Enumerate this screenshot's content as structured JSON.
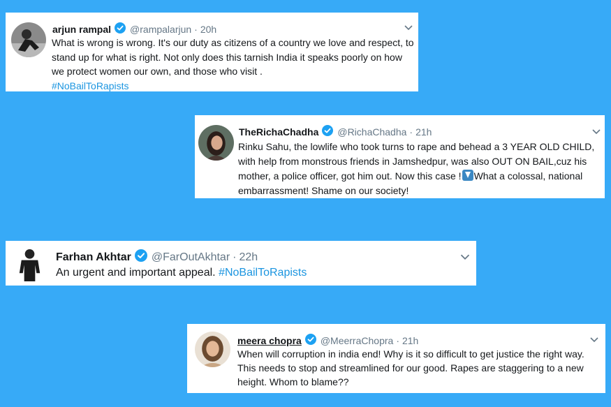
{
  "tweets": [
    {
      "name": "arjun rampal",
      "handle": "@rampalarjun",
      "separator": "·",
      "time": "20h",
      "text": "What is wrong is wrong. It's our duty as citizens of a country we love and respect, to stand up for what is right. Not only does this tarnish India it speaks poorly on how we protect women our own, and those who visit .",
      "hashtag": "#NoBailToRapists",
      "avatar_icon": "person-photo-avatar",
      "menu_icon": "chevron-down-icon"
    },
    {
      "name": "TheRichaChadha",
      "handle": "@RichaChadha",
      "separator": "·",
      "time": "21h",
      "text_before_emoji": "Rinku Sahu, the lowlife who took turns to rape and behead a 3 YEAR OLD CHILD, with help from monstrous friends in Jamshedpur, was also OUT ON BAIL,cuz his mother, a police officer, got him out. Now this case !",
      "emoji": "down-arrow-emoji",
      "text_after_emoji": "What a colossal, national embarrassment! Shame on our society!",
      "avatar_icon": "person-photo-avatar",
      "menu_icon": "chevron-down-icon"
    },
    {
      "name": "Farhan Akhtar",
      "handle": "@FarOutAkhtar",
      "separator": "·",
      "time": "22h",
      "text": "An urgent and important appeal.",
      "hashtag": "#NoBailToRapists",
      "avatar_icon": "person-photo-avatar",
      "menu_icon": "chevron-down-icon"
    },
    {
      "name": "meera chopra",
      "handle": "@MeerraChopra",
      "separator": "·",
      "time": "21h",
      "text": "When will corruption in india end! Why is it so difficult to get justice the right way. This needs to stop and streamlined for our good. Rapes are staggering to a new height. Whom to blame??",
      "avatar_icon": "person-photo-avatar",
      "menu_icon": "chevron-down-icon"
    }
  ],
  "colors": {
    "background": "#37aaf7",
    "verified": "#1da1f2",
    "hashtag": "#1b95e0",
    "secondary_text": "#657786"
  }
}
